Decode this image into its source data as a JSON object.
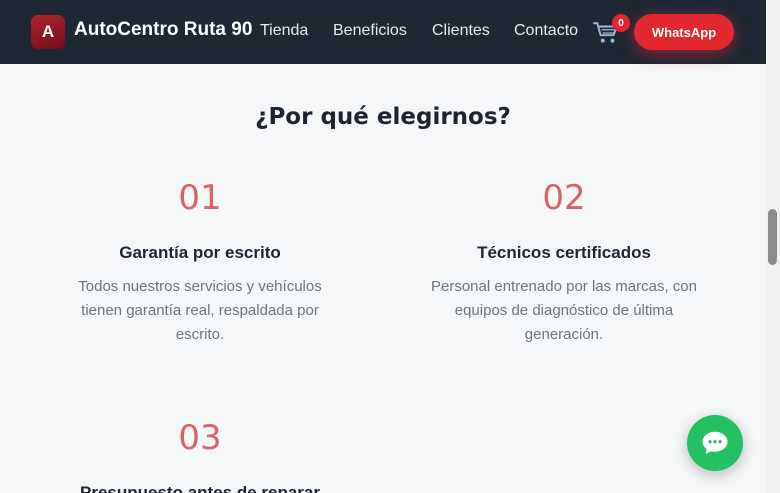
{
  "navbar": {
    "logo_letter": "A",
    "brand": "AutoCentro Ruta 90",
    "links": [
      "Tienda",
      "Beneficios",
      "Clientes",
      "Contacto"
    ],
    "cart_icon": "shopping-cart-icon",
    "cart_count": "0",
    "whatsapp_label": "WhatsApp"
  },
  "section": {
    "title": "¿Por qué elegirnos?",
    "features": [
      {
        "number": "01",
        "title": "Garantía por escrito",
        "description": "Todos nuestros servicios y vehículos tienen garantía real, respaldada por escrito."
      },
      {
        "number": "02",
        "title": "Técnicos certificados",
        "description": "Personal entrenado por las marcas, con equipos de diagnóstico de última generación."
      },
      {
        "number": "03",
        "title": "Presupuesto antes de reparar",
        "description": ""
      }
    ]
  },
  "floating": {
    "icon": "chat-bubble-icon"
  },
  "colors": {
    "navbar_bg": "#1f2735",
    "accent_red": "#e0282e",
    "number_red": "#d86467",
    "whatsapp_green": "#23c15f"
  }
}
